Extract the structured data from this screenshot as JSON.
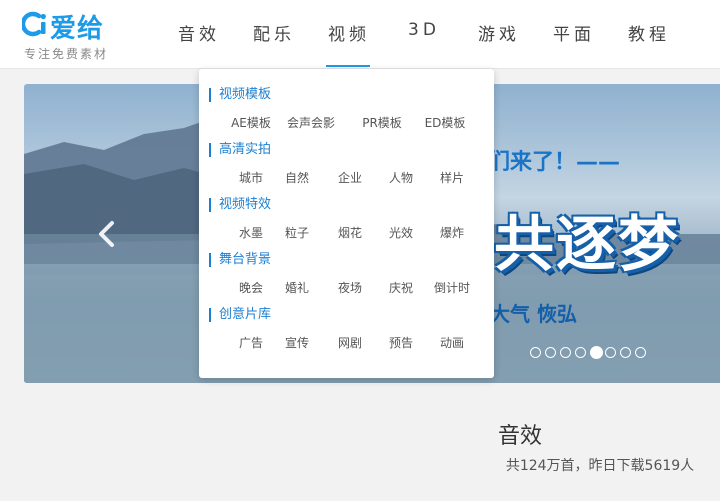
{
  "logo": {
    "name": "爱给",
    "slogan": "专注免费素材",
    "mark": "ci-logo-icon"
  },
  "nav": {
    "items": [
      "音效",
      "配乐",
      "视频",
      "3D",
      "游戏",
      "平面",
      "教程"
    ],
    "active": "视频"
  },
  "dropdown": {
    "groups": [
      {
        "title": "视频模板",
        "items": [
          "AE模板",
          "会声会影",
          "PR模板",
          "ED模板"
        ]
      },
      {
        "title": "高清实拍",
        "items": [
          "城市",
          "自然",
          "企业",
          "人物",
          "样片"
        ]
      },
      {
        "title": "视频特效",
        "items": [
          "水墨",
          "粒子",
          "烟花",
          "光效",
          "爆炸"
        ]
      },
      {
        "title": "舞台背景",
        "items": [
          "晚会",
          "婚礼",
          "夜场",
          "庆祝",
          "倒计时"
        ]
      },
      {
        "title": "创意片库",
        "items": [
          "广告",
          "宣传",
          "网剧",
          "预告",
          "动画"
        ]
      }
    ]
  },
  "banner": {
    "tag": "们来了！——",
    "headline": "共逐梦",
    "sub": "大气 恢弘",
    "dot_count": 8,
    "active_dot": 4,
    "prev_icon": "chevron-left-icon"
  },
  "section": {
    "title": "音效",
    "stats": "共124万首，昨日下载5619人"
  },
  "colors": {
    "accent": "#1e9be8",
    "link": "#1e7fd1"
  }
}
